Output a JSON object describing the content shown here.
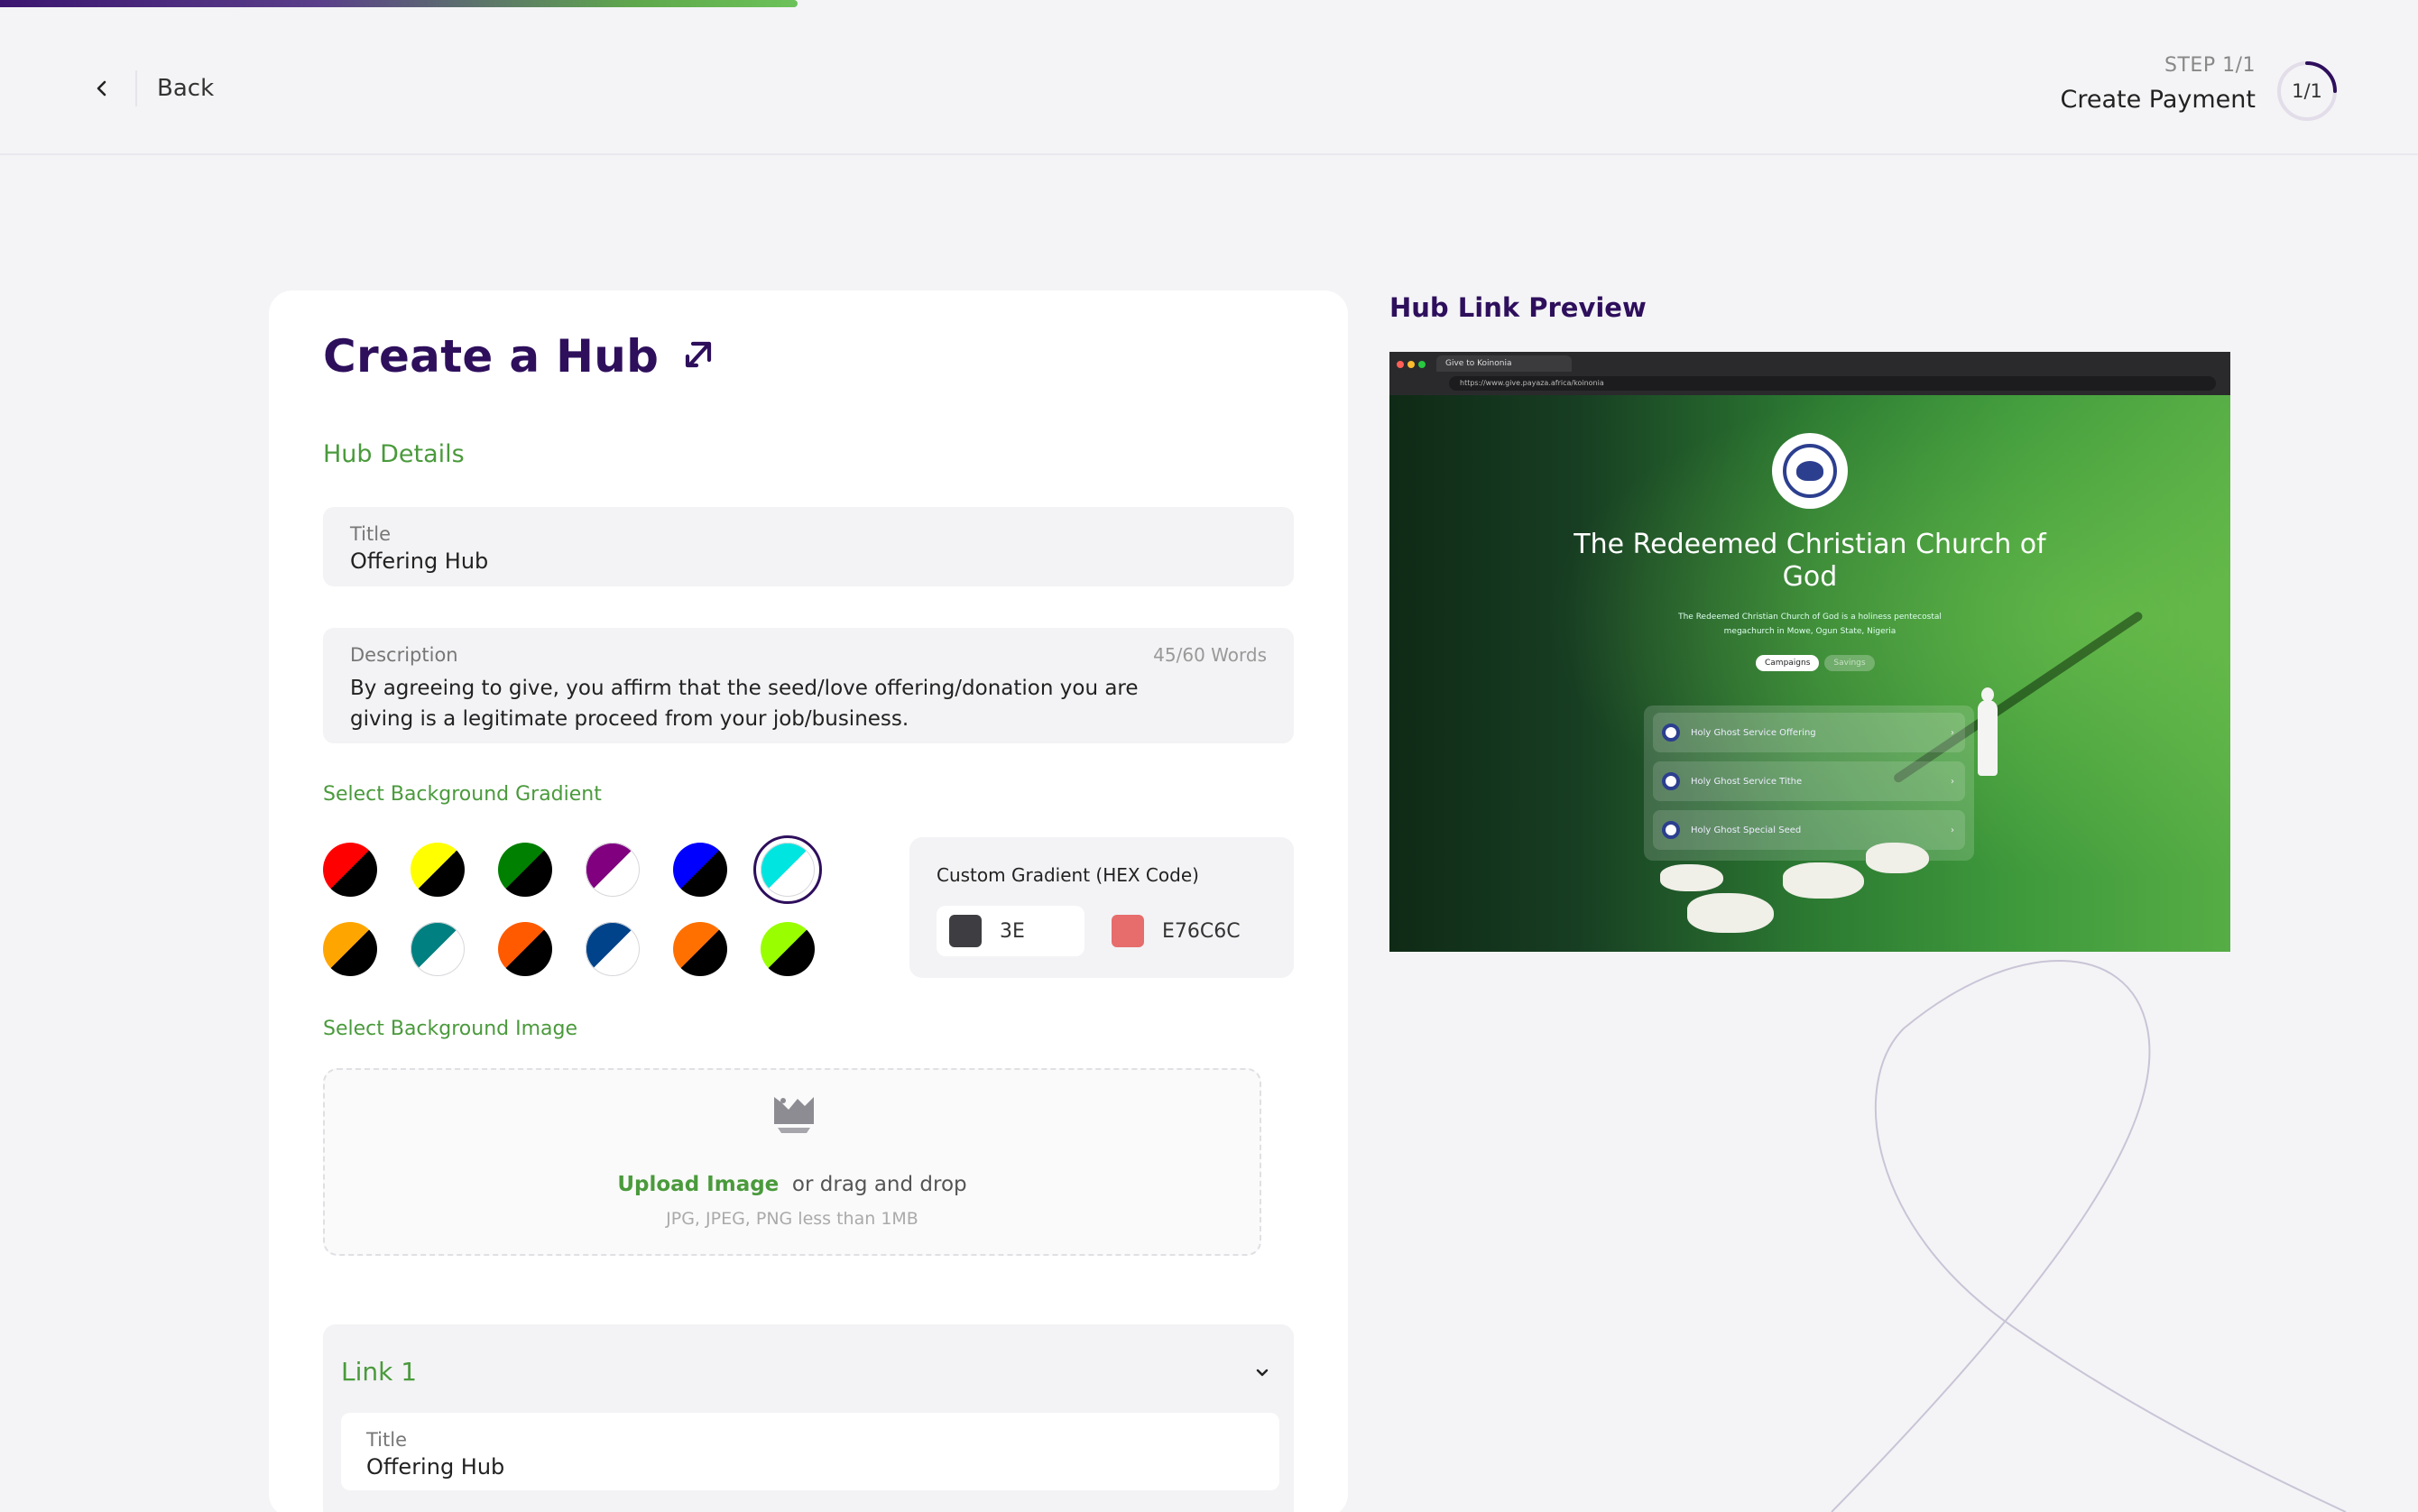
{
  "header": {
    "back_label": "Back",
    "step_count": "STEP 1/1",
    "step_title": "Create Payment",
    "step_ring_label": "1/1",
    "progress_fraction": 0.33
  },
  "form": {
    "title": "Create a Hub",
    "section_hub_details": "Hub Details",
    "title_field": {
      "label": "Title",
      "value": "Offering Hub"
    },
    "description_field": {
      "label": "Description",
      "count": "45/60 Words",
      "value": "By agreeing to give, you affirm that the seed/love offering/donation you are giving  is a legitimate proceed from your job/business."
    },
    "gradient_label": "Select Background Gradient",
    "gradients": [
      {
        "name": "red-black",
        "from": "#ff0000",
        "to": "#000000"
      },
      {
        "name": "yellow-black",
        "from": "#ffff00",
        "to": "#000000"
      },
      {
        "name": "green-black",
        "from": "#008000",
        "to": "#000000"
      },
      {
        "name": "purple-white",
        "from": "#800080",
        "to": "#ffffff"
      },
      {
        "name": "blue-black",
        "from": "#0000ff",
        "to": "#000000"
      },
      {
        "name": "cyan-white",
        "from": "#00e5e0",
        "to": "#ffffff",
        "selected": true
      },
      {
        "name": "orange-black",
        "from": "#ffa500",
        "to": "#000000"
      },
      {
        "name": "teal-white",
        "from": "#008080",
        "to": "#ffffff"
      },
      {
        "name": "orangered-black",
        "from": "#ff5a00",
        "to": "#000000"
      },
      {
        "name": "navy-white",
        "from": "#00438a",
        "to": "#ffffff"
      },
      {
        "name": "darkorange-black",
        "from": "#ff7000",
        "to": "#000000"
      },
      {
        "name": "lime-black",
        "from": "#99ff00",
        "to": "#000000"
      }
    ],
    "custom_gradient": {
      "title": "Custom Gradient (HEX Code)",
      "color1": {
        "value": "3E",
        "swatch": "#3e3e42"
      },
      "color2": {
        "value": "E76C6C",
        "swatch": "#e76c6c"
      }
    },
    "image_label": "Select Background Image",
    "upload": {
      "link": "Upload Image",
      "rest": "or drag and drop",
      "hint": "JPG, JPEG, PNG less than 1MB"
    },
    "link1": {
      "title": "Link 1",
      "field_label": "Title",
      "field_value": "Offering Hub"
    }
  },
  "preview": {
    "title": "Hub Link Preview",
    "browser_tab": "Give to Koinonia",
    "browser_url": "https://www.give.payaza.africa/koinonia",
    "church_name": "The Redeemed Christian Church of God",
    "church_desc": "The Redeemed Christian Church of God is a holiness pentecostal megachurch in Mowe, Ogun State, Nigeria",
    "pill_active": "Campaigns",
    "pill_inactive": "Savings",
    "campaigns": [
      "Holy Ghost Service Offering",
      "Holy Ghost Service Tithe",
      "Holy Ghost Special Seed"
    ]
  },
  "colors": {
    "brand_purple": "#2e0f5c",
    "brand_green": "#4a9a3c",
    "background": "#f4f4f6"
  }
}
